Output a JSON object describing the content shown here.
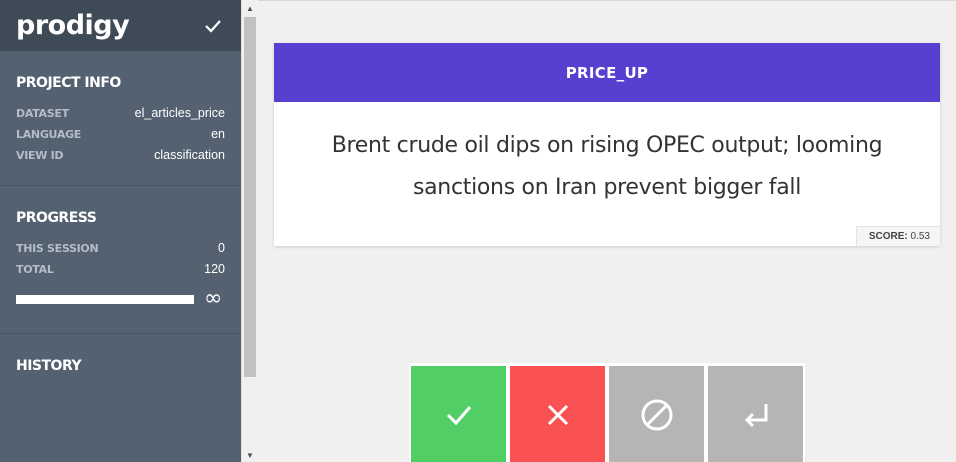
{
  "app": {
    "logo": "prodigy",
    "save_icon": "check-icon"
  },
  "project_info": {
    "title": "PROJECT INFO",
    "rows": [
      {
        "key": "DATASET",
        "value": "el_articles_price"
      },
      {
        "key": "LANGUAGE",
        "value": "en"
      },
      {
        "key": "VIEW ID",
        "value": "classification"
      }
    ]
  },
  "progress": {
    "title": "PROGRESS",
    "rows": [
      {
        "key": "THIS SESSION",
        "value": "0"
      },
      {
        "key": "TOTAL",
        "value": "120"
      }
    ],
    "bar_fraction": 1.0,
    "infinity": "∞"
  },
  "history": {
    "title": "HISTORY"
  },
  "task": {
    "label": "PRICE_UP",
    "text": "Brent crude oil dips on rising OPEC output; looming sanctions on Iran prevent bigger fall",
    "score_label": "SCORE:",
    "score_value": "0.53"
  },
  "colors": {
    "sidebar": "#536171",
    "sidebar_header": "#3f4a57",
    "label_bar": "#583fcf",
    "accept": "#51cf66",
    "reject": "#fa5252",
    "ignore": "#b5b5b5",
    "undo": "#b5b5b5"
  },
  "actions": [
    {
      "name": "accept",
      "icon": "check-icon"
    },
    {
      "name": "reject",
      "icon": "close-icon"
    },
    {
      "name": "ignore",
      "icon": "ban-icon"
    },
    {
      "name": "undo",
      "icon": "undo-arrow-icon"
    }
  ]
}
